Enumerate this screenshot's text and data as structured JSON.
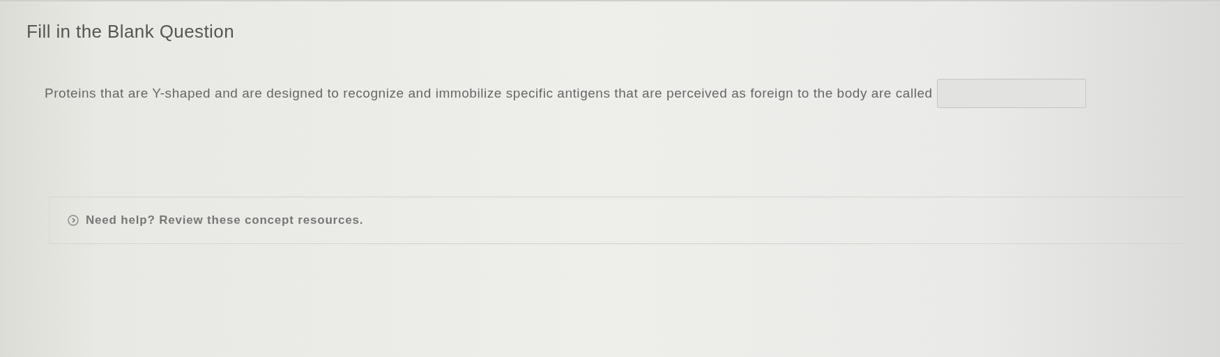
{
  "title": "Fill in the Blank Question",
  "question": {
    "text": "Proteins that are Y-shaped and are designed to recognize and immobilize specific antigens that are perceived as foreign to the body are called"
  },
  "help": {
    "label": "Need help? Review these concept resources.",
    "expanded": false
  }
}
